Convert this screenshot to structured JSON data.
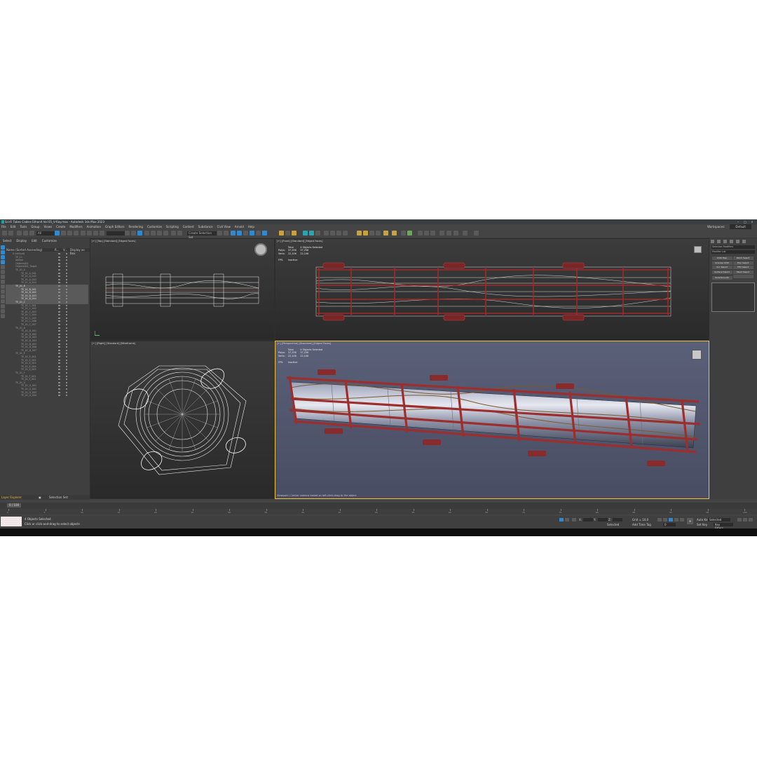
{
  "window": {
    "title": "Sci-Fi Tubes Cables Ethanlt Vol 05_V-Ray.max - Autodesk 3ds Max 2023"
  },
  "menu": [
    "File",
    "Edit",
    "Tools",
    "Group",
    "Views",
    "Create",
    "Modifiers",
    "Animation",
    "Graph Editors",
    "Rendering",
    "Customize",
    "Scripting",
    "Content",
    "Substance",
    "Civil View",
    "Arnold",
    "Help"
  ],
  "workspaces": {
    "label": "Workspaces:",
    "value": "Default"
  },
  "toolbar": {
    "filter": "All",
    "selection_set": "Create Selection Set"
  },
  "explorer": {
    "tabs": [
      "Select",
      "Display",
      "Edit",
      "Customize"
    ],
    "columns": {
      "name": "Name (Sorted Ascending)",
      "render": "R...",
      "vis": "V...",
      "display": "Display as Box"
    },
    "rows": [
      "0 (default)",
      "TE_11",
      "abelon",
      "Objects001",
      "Objects001_Target",
      "TE_01_A",
      "TE_01_A_001",
      "TE_01_A_002",
      "TE_01_A_003",
      "TE_01_A_004",
      "TE_01_B",
      "TE_01_B_001",
      "TE_01_B_002",
      "TE_01_B_003",
      "TE_01_B_004",
      "TE_01_C",
      "TE_01_C_001",
      "TE_01_C_002",
      "TE_01_C_003",
      "TE_01_C_004",
      "TE_01_C_005",
      "TE_01_C_006",
      "TE_01_C_007",
      "TE_01_D",
      "TE_01_D_001",
      "TE_01_D_002",
      "TE_01_D_003",
      "TE_01_D_004",
      "TE_01_D_005",
      "TE_01_D_006",
      "TE_01_D_007",
      "TE_01_E",
      "TE_01_E_001",
      "TE_01_E_002",
      "TE_01_E_003",
      "TE_01_E_004",
      "TE_01_E_005",
      "TE_01_F",
      "TE_01_F_001",
      "TE_01_F_002",
      "TE_01_G",
      "TE_01_G_001",
      "TE_01_G_002",
      "TE_01_G_003",
      "TE_01_G_004"
    ],
    "highlighted": [
      10,
      11,
      12,
      13,
      14,
      15
    ],
    "layer_explorer": "Layer Explorer",
    "selection_set": "Selection Set:"
  },
  "viewports": {
    "top": {
      "label": "[+] [Top] [Standard] [Edged Faces]"
    },
    "front": {
      "label": "[+] [Front] [Standard] [Edged Faces]",
      "stats": {
        "total": "Total",
        "sel": "4 Objects Selected",
        "polys_label": "Polys:",
        "polys_total": "37,256",
        "polys_sel": "37,256",
        "verts_label": "Verts:",
        "verts_total": "22,106",
        "verts_sel": "22,106",
        "fps_label": "FPS:",
        "fps_val": "Inactive"
      }
    },
    "right": {
      "label": "[+] [Right] [Standard] [Wireframe]"
    },
    "persp": {
      "label": "[+] [Perspective] [Standard] [Edged Faces]",
      "stats": {
        "total": "Total",
        "sel": "4 Objects Selected",
        "polys_label": "Polys:",
        "polys_total": "37,256",
        "polys_sel": "37,256",
        "verts_label": "Verts:",
        "verts_total": "22,106",
        "verts_sel": "22,106",
        "fps_label": "FPS:",
        "fps_val": "Inactive"
      },
      "footer": "Viewport / Center camera based on left-click-drag to the object"
    }
  },
  "command_panel": {
    "field1": "Selection Modifiers",
    "field2": "Modifier List",
    "buttons": [
      "UVW Map",
      "Patch Select",
      "Unwrap UVW",
      "Poly Select",
      "Vol. Select",
      "FFD Select",
      "Surface Select",
      "Mesh Select",
      "TurboSmooth",
      ""
    ]
  },
  "timeline": {
    "frame": "0 / 100"
  },
  "ticks": [
    "0",
    "5",
    "10",
    "15",
    "20",
    "25",
    "30",
    "35",
    "40",
    "45",
    "50",
    "55",
    "60",
    "65",
    "70",
    "75",
    "80",
    "85",
    "90",
    "95",
    "100"
  ],
  "status": {
    "line1": "4 Objects Selected",
    "line2": "Click or click-and-drag to select objects",
    "selected_label": "Selected",
    "grid": "Grid = 10.0",
    "addtimetag": "Add Time Tag",
    "autokey": "Auto Key",
    "setkey": "Set Key",
    "keyfilters": "Key Filters...",
    "x": "X:",
    "y": "Y:",
    "z": "Z:",
    "frame_field": "0",
    "selected_dd": "Selected"
  },
  "colors": {
    "accent": "#2e8bd1",
    "viewport_active": "#f2c23a",
    "frame_red": "#a8282c",
    "persp_bg": "#515771"
  }
}
